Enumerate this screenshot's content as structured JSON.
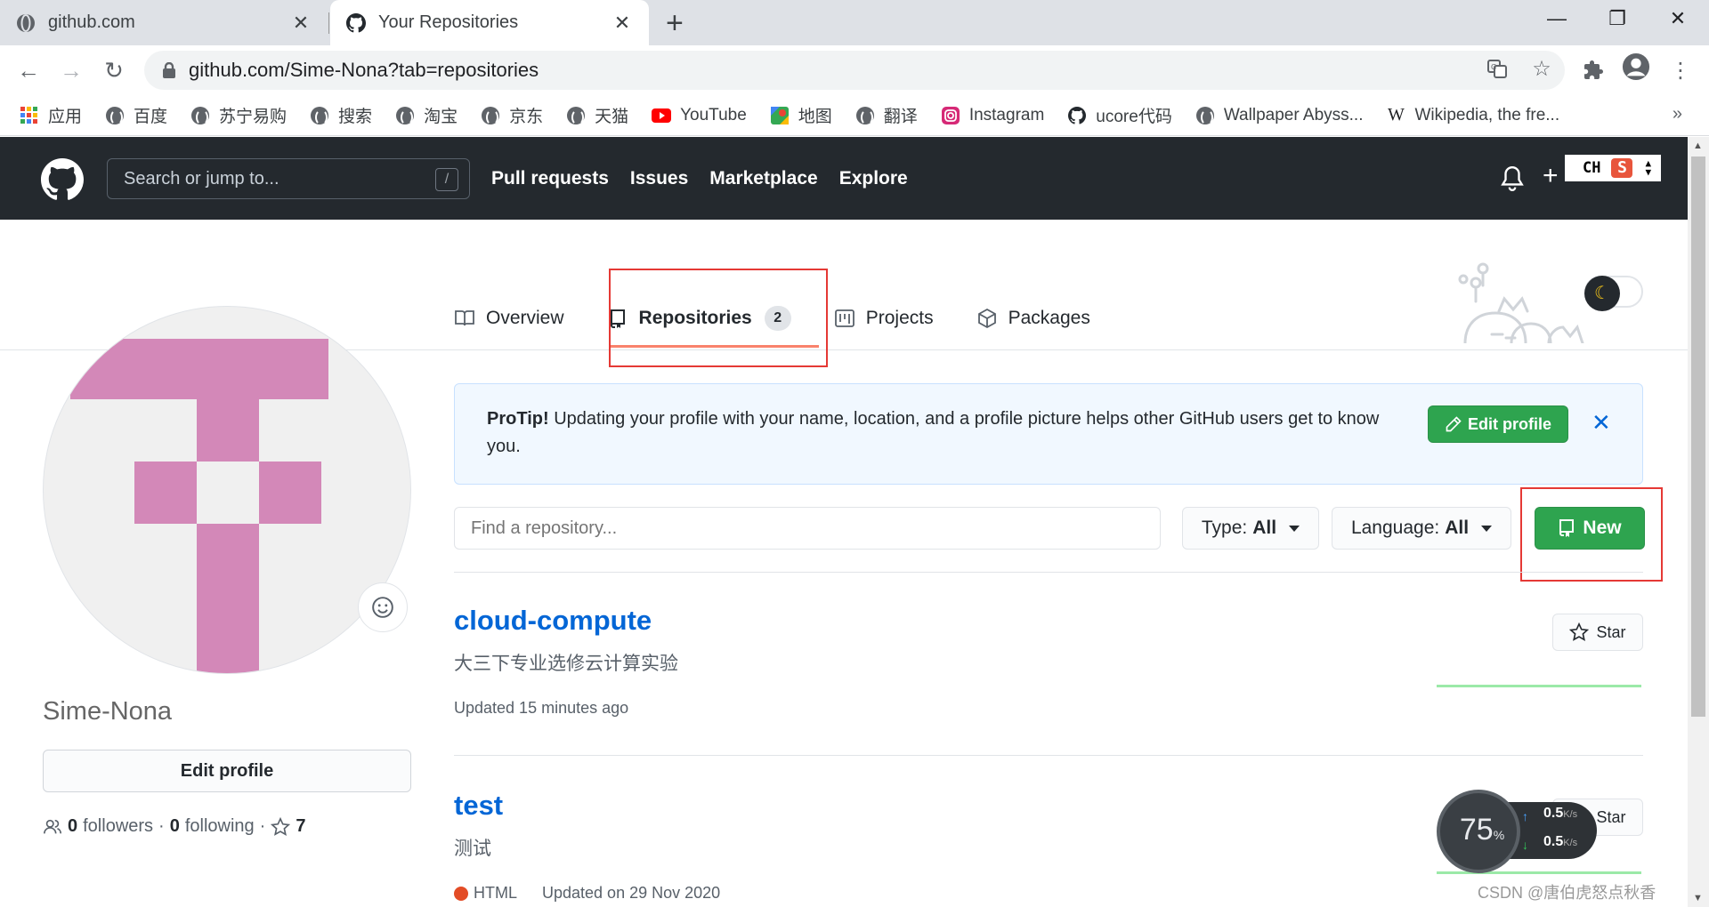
{
  "browser": {
    "tabs": [
      {
        "title": "github.com",
        "active": false
      },
      {
        "title": "Your Repositories",
        "active": true
      }
    ],
    "url": "github.com/Sime-Nona?tab=repositories",
    "bookmarks": [
      {
        "label": "应用",
        "icon": "apps-grid-icon"
      },
      {
        "label": "百度",
        "icon": "globe-icon"
      },
      {
        "label": "苏宁易购",
        "icon": "globe-icon"
      },
      {
        "label": "搜索",
        "icon": "globe-icon"
      },
      {
        "label": "淘宝",
        "icon": "globe-icon"
      },
      {
        "label": "京东",
        "icon": "globe-icon"
      },
      {
        "label": "天猫",
        "icon": "globe-icon"
      },
      {
        "label": "YouTube",
        "icon": "youtube-icon"
      },
      {
        "label": "地图",
        "icon": "maps-icon"
      },
      {
        "label": "翻译",
        "icon": "globe-icon"
      },
      {
        "label": "Instagram",
        "icon": "instagram-icon"
      },
      {
        "label": "ucore代码",
        "icon": "github-icon"
      },
      {
        "label": "Wallpaper Abyss...",
        "icon": "globe-icon"
      },
      {
        "label": "Wikipedia, the fre...",
        "icon": "wikipedia-icon"
      }
    ],
    "bookmarks_more": "»"
  },
  "github": {
    "search_placeholder": "Search or jump to...",
    "search_shortcut": "/",
    "nav": [
      "Pull requests",
      "Issues",
      "Marketplace",
      "Explore"
    ],
    "ime_text": "CH",
    "ime_logo": "S"
  },
  "profile_tabs": [
    {
      "label": "Overview",
      "icon": "book-icon",
      "selected": false
    },
    {
      "label": "Repositories",
      "icon": "repo-icon",
      "selected": true,
      "count": "2"
    },
    {
      "label": "Projects",
      "icon": "project-icon",
      "selected": false
    },
    {
      "label": "Packages",
      "icon": "package-icon",
      "selected": false
    }
  ],
  "sidebar": {
    "username": "Sime-Nona",
    "edit_profile_label": "Edit profile",
    "followers_count": "0",
    "followers_label": "followers",
    "following_count": "0",
    "following_label": "following",
    "stars_count": "7",
    "avatar_color": "#d388b8"
  },
  "protip": {
    "lead": "ProTip!",
    "text": " Updating your profile with your name, location, and a profile picture helps other GitHub users get to know you.",
    "button_label": "Edit profile",
    "close": "✕"
  },
  "filters": {
    "find_placeholder": "Find a repository...",
    "type_label": "Type:",
    "type_value": "All",
    "language_label": "Language:",
    "language_value": "All",
    "new_label": "New"
  },
  "repos": [
    {
      "name": "cloud-compute",
      "description": "大三下专业选修云计算实验",
      "language": "",
      "updated": "Updated 15 minutes ago",
      "star_label": "Star"
    },
    {
      "name": "test",
      "description": "测试",
      "language": "HTML",
      "language_color": "#e34c26",
      "updated": "Updated on 29 Nov 2020",
      "star_label": "Star"
    }
  ],
  "netmon": {
    "percent": "75",
    "percent_unit": "%",
    "up": "0.5",
    "down": "0.5",
    "unit": "K/s"
  },
  "watermark": "CSDN @唐伯虎怒点秋香",
  "colors": {
    "accent_green": "#2ea44f",
    "link_blue": "#0366d6",
    "header_dark": "#24292e",
    "tab_underline": "#f9826c",
    "highlight_red": "#e53935"
  }
}
